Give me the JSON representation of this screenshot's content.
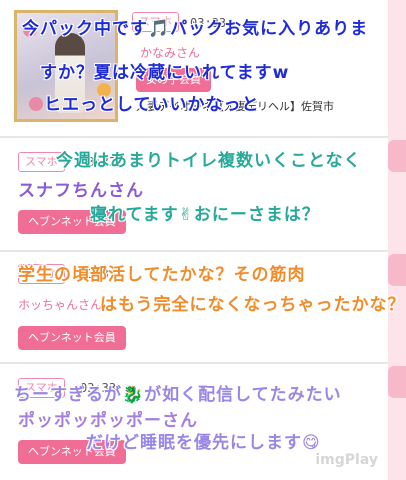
{
  "cards": [
    {
      "tag": "スマホ",
      "time": "03:33",
      "name": "かなみさん",
      "badge": "女の子会員",
      "shop": "人妻デイオーネ【人妻デリヘル】佐賀市"
    },
    {
      "tag": "スマホ",
      "time": "03:33",
      "name": "スナフちんさん",
      "badge": "ヘブンネット会員"
    },
    {
      "tag": "スマホ",
      "time": "03:33",
      "name": "ホッちゃんさん",
      "badge": "ヘブンネット会員"
    },
    {
      "tag": "スマホ",
      "time": "03:33",
      "name": "ポッポッポッポーさん",
      "badge": "ヘブンネット会員"
    }
  ],
  "overlays": {
    "c1_l1": "今パック中です🎵パックお気に入りありま",
    "c1_l2": "すか？夏は冷蔵にいれてますw",
    "c1_l3": "ヒエっとしていいかなっと",
    "c2_l1": "今週はあまりトイレ複数いくことなく",
    "c2_l2": "スナフちんさん",
    "c2_l3": "寝れてます✌おにーさまは？",
    "c3_l1": "学生の頃部活してたかな？その筋肉",
    "c3_l2": "はもう完全になくなっちゃったかな？",
    "c4_l1": "ちーすぎるが🐉が如く配信してたみたい",
    "c4_l2": "ポッポッポッポーさん",
    "c4_l3": "だけど睡眠を優先にします😋"
  },
  "watermark": "imgPlay",
  "colors": {
    "accent_pink": "#f06e96",
    "rail": "#fde3ea"
  }
}
